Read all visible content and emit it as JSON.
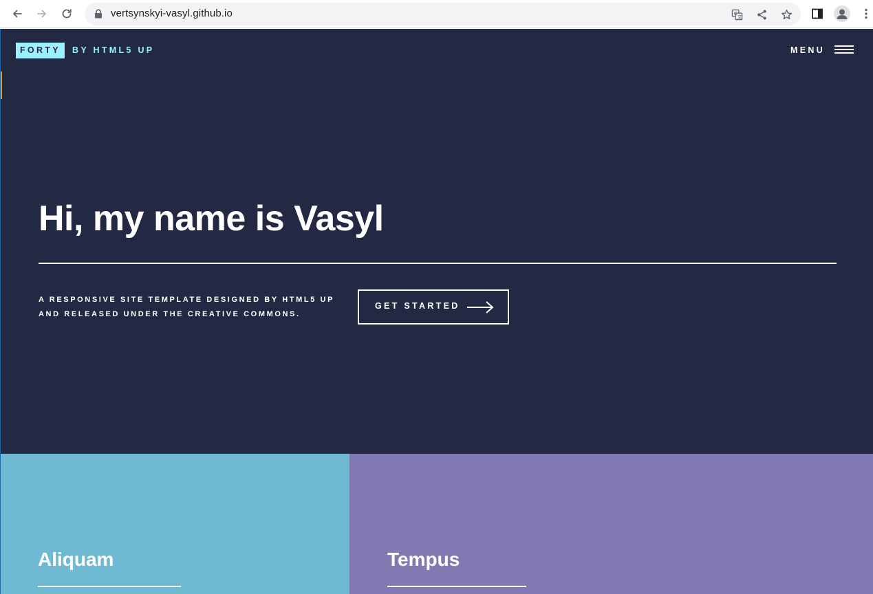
{
  "browser": {
    "url": "vertsynskyi-vasyl.github.io",
    "icons": [
      "back-icon",
      "forward-icon",
      "reload-icon",
      "lock-icon",
      "translate-icon",
      "share-icon",
      "star-icon",
      "side-panel-icon",
      "profile-icon",
      "more-icon"
    ]
  },
  "header": {
    "logo": "FORTY",
    "logo_by": "BY HTML5 UP",
    "menu_label": "MENU"
  },
  "hero": {
    "title": "Hi, my name is Vasyl",
    "subtitle_line1": "A RESPONSIVE SITE TEMPLATE DESIGNED BY HTML5 UP",
    "subtitle_line2": "AND RELEASED UNDER THE CREATIVE COMMONS.",
    "cta_label": "GET STARTED"
  },
  "tiles": [
    {
      "title": "Aliquam",
      "color": "#6fb9d2"
    },
    {
      "title": "Tempus",
      "color": "#8179b2"
    }
  ],
  "colors": {
    "background": "#242943",
    "accent": "#9bf1ff"
  }
}
